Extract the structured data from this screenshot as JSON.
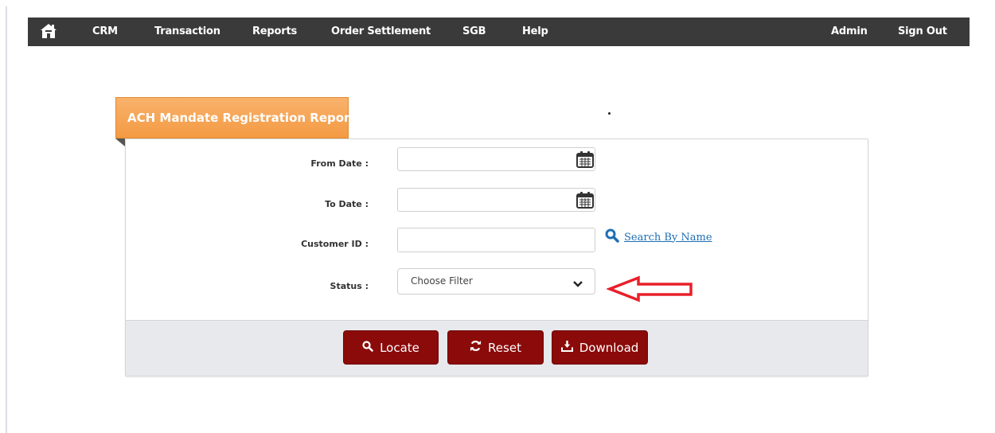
{
  "nav": {
    "home_icon": "home-icon",
    "items": [
      "CRM",
      "Transaction",
      "Reports",
      "Order Settlement",
      "SGB",
      "Help"
    ],
    "right_items": [
      "Admin",
      "Sign Out"
    ]
  },
  "report": {
    "title": "ACH Mandate Registration Report",
    "fields": {
      "from_date": {
        "label": "From Date :",
        "value": "",
        "icon": "calendar-icon"
      },
      "to_date": {
        "label": "To Date :",
        "value": "",
        "icon": "calendar-icon"
      },
      "customer_id": {
        "label": "Customer ID :",
        "value": ""
      },
      "status": {
        "label": "Status :",
        "selected": "Choose Filter"
      }
    },
    "search_by_name": "Search By Name",
    "annotation": "red-arrow-icon"
  },
  "buttons": {
    "locate": "Locate",
    "reset": "Reset",
    "download": "Download"
  },
  "colors": {
    "nav_bg": "#3a3a3a",
    "tab_orange": "#f5a04f",
    "button_red": "#8b0a0a",
    "link_blue": "#1e6fb5",
    "annotation_red": "#e8202a"
  }
}
